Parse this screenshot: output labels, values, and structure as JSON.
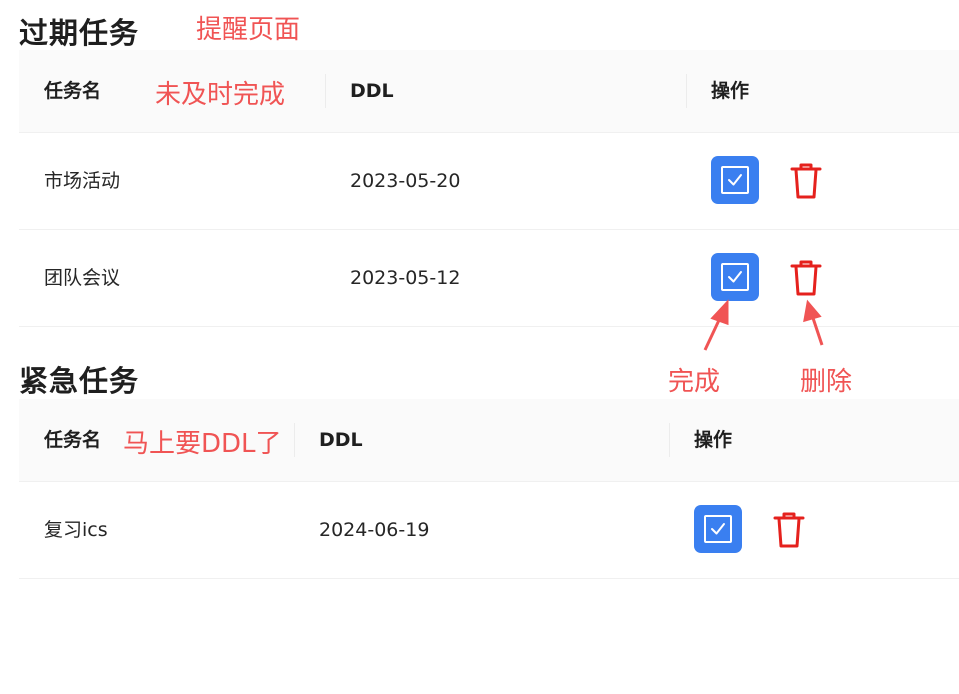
{
  "overdue": {
    "title": "过期任务",
    "columns": {
      "name": "任务名",
      "ddl": "DDL",
      "actions": "操作"
    },
    "rows": [
      {
        "name": "市场活动",
        "ddl": "2023-05-20"
      },
      {
        "name": "团队会议",
        "ddl": "2023-05-12"
      }
    ]
  },
  "urgent": {
    "title": "紧急任务",
    "columns": {
      "name": "任务名",
      "ddl": "DDL",
      "actions": "操作"
    },
    "rows": [
      {
        "name": "复习ics",
        "ddl": "2024-06-19"
      }
    ]
  },
  "annotations": {
    "page": "提醒页面",
    "overdue_note": "未及时完成",
    "urgent_note": "马上要DDL了",
    "complete": "完成",
    "delete": "删除"
  },
  "icons": {
    "complete": "checkbox-icon",
    "delete": "trash-icon"
  },
  "colors": {
    "accent": "#3a7ff0",
    "danger": "#e5211d",
    "annotation": "#f05454"
  }
}
